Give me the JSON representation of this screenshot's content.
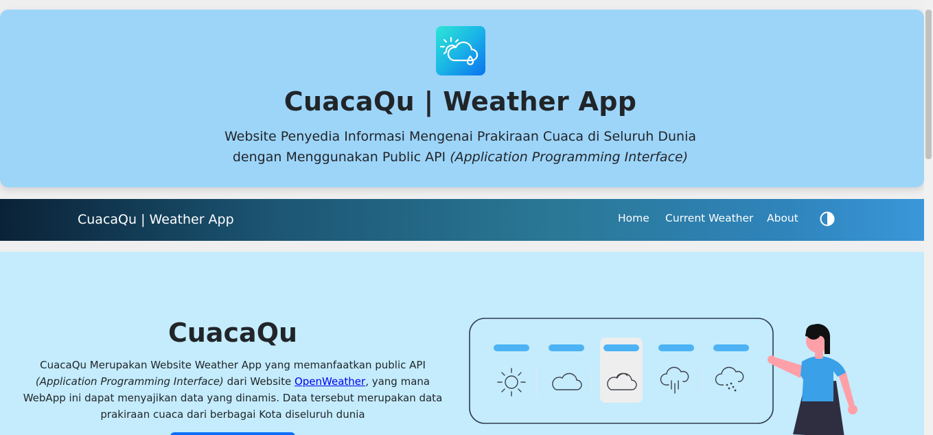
{
  "hero": {
    "title": "CuacaQu | Weather App",
    "subtitle_line1": "Website Penyedia Informasi Mengenai Prakiraan Cuaca di Seluruh Dunia",
    "subtitle_line2": "dengan Menggunakan Public API ",
    "subtitle_line2_italic": "(Application Programming Interface)",
    "logo_icon": "cloud-sun-rain-icon"
  },
  "navbar": {
    "brand": "CuacaQu | Weather App",
    "links": [
      "Home",
      "Current Weather",
      "About"
    ],
    "theme_icon": "contrast-toggle-icon"
  },
  "about": {
    "title": "CuacaQu",
    "text_part1": "CuacaQu Merupakan Website Weather App yang memanfaatkan public API ",
    "text_italic": "(Application Programming Interface)",
    "text_part2": " dari Website ",
    "link": "OpenWeather",
    "text_part3": ", yang mana WebApp ini dapat menyajikan data yang dinamis. Data tersebut merupakan data prakiraan cuaca dari berbagai Kota diseluruh dunia"
  },
  "illustration": {
    "icons": [
      "sun-icon",
      "cloud-icon",
      "cloud-sun-icon",
      "cloud-rain-icon",
      "cloud-snow-icon"
    ]
  },
  "colors": {
    "hero_bg": "#9dd5f9",
    "main_bg": "#c4ecfd",
    "accent_blue": "#4db3f5",
    "link": "#0000ee"
  }
}
